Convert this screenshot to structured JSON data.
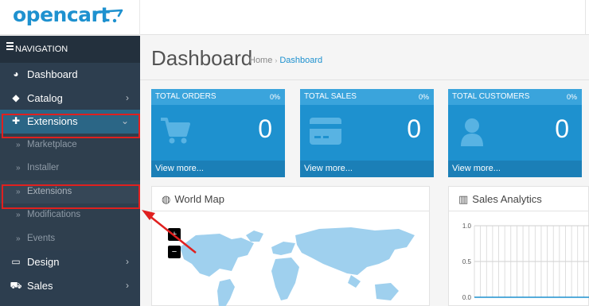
{
  "brand": {
    "logo_text": "opencart",
    "brand_color": "#1e91cf"
  },
  "sidebar": {
    "header": "NAVIGATION",
    "items": [
      {
        "label": "Dashboard",
        "icon": "dashboard-icon"
      },
      {
        "label": "Catalog",
        "icon": "tag-icon",
        "arrow": "›"
      },
      {
        "label": "Extensions",
        "icon": "puzzle-icon",
        "arrow": "⌄"
      }
    ],
    "sub_items": [
      {
        "label": "Marketplace"
      },
      {
        "label": "Installer"
      },
      {
        "label": "Extensions"
      },
      {
        "label": "Modifications"
      },
      {
        "label": "Events"
      }
    ],
    "bottom_items": [
      {
        "label": "Design",
        "icon": "monitor-icon",
        "arrow": "›"
      },
      {
        "label": "Sales",
        "icon": "shopping-cart-icon",
        "arrow": "›"
      }
    ]
  },
  "page": {
    "title": "Dashboard",
    "breadcrumb": {
      "home": "Home",
      "sep": "›",
      "current": "Dashboard"
    }
  },
  "tiles": [
    {
      "title": "TOTAL ORDERS",
      "percent": "0%",
      "value": "0",
      "link": "View more...",
      "icon": "cart-icon"
    },
    {
      "title": "TOTAL SALES",
      "percent": "0%",
      "value": "0",
      "link": "View more...",
      "icon": "credit-card-icon"
    },
    {
      "title": "TOTAL CUSTOMERS",
      "percent": "0%",
      "value": "0",
      "link": "View more...",
      "icon": "user-icon"
    }
  ],
  "panels": {
    "world_map": {
      "title": "World Map",
      "zoom_in": "+",
      "zoom_out": "−"
    },
    "sales_analytics": {
      "title": "Sales Analytics",
      "y_ticks": [
        "1.0",
        "0.5",
        "0.0"
      ]
    }
  },
  "chart_data": {
    "type": "line",
    "title": "Sales Analytics",
    "ylim": [
      0,
      1
    ],
    "y_ticks": [
      0.0,
      0.5,
      1.0
    ],
    "series": [
      {
        "values": [
          0,
          0,
          0,
          0,
          0,
          0,
          0,
          0,
          0,
          0,
          0,
          0,
          0,
          0,
          0,
          0,
          0,
          0,
          0,
          0
        ]
      }
    ],
    "grid": true
  },
  "colors": {
    "sidebar_bg": "#2d3e4f",
    "tile_bg": "#1e91cf",
    "highlight": "#e0201f"
  }
}
